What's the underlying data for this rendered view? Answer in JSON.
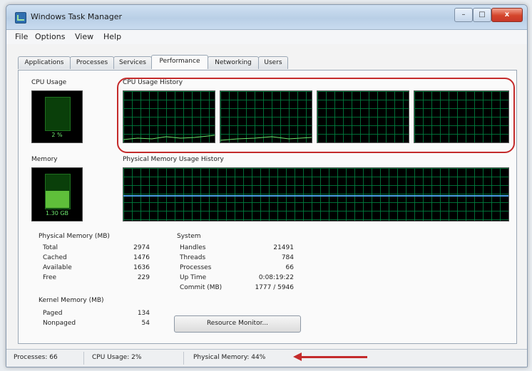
{
  "window": {
    "title": "Windows Task Manager",
    "controls": {
      "minimize": "–",
      "maximize": "□",
      "close": "x"
    }
  },
  "menu": [
    "File",
    "Options",
    "View",
    "Help"
  ],
  "tabs": [
    {
      "label": "Applications",
      "active": false
    },
    {
      "label": "Processes",
      "active": false
    },
    {
      "label": "Services",
      "active": false
    },
    {
      "label": "Performance",
      "active": true
    },
    {
      "label": "Networking",
      "active": false
    },
    {
      "label": "Users",
      "active": false
    }
  ],
  "performance": {
    "cpu_usage_label": "CPU Usage",
    "cpu_usage_value": "2 %",
    "cpu_history_label": "CPU Usage History",
    "memory_label": "Memory",
    "memory_value": "1.30 GB",
    "memory_history_label": "Physical Memory Usage History"
  },
  "physical_memory": {
    "title": "Physical Memory (MB)",
    "rows": [
      {
        "key": "Total",
        "value": "2974"
      },
      {
        "key": "Cached",
        "value": "1476"
      },
      {
        "key": "Available",
        "value": "1636"
      },
      {
        "key": "Free",
        "value": "229"
      }
    ]
  },
  "kernel_memory": {
    "title": "Kernel Memory (MB)",
    "rows": [
      {
        "key": "Paged",
        "value": "134"
      },
      {
        "key": "Nonpaged",
        "value": "54"
      }
    ]
  },
  "system": {
    "title": "System",
    "rows": [
      {
        "key": "Handles",
        "value": "21491"
      },
      {
        "key": "Threads",
        "value": "784"
      },
      {
        "key": "Processes",
        "value": "66"
      },
      {
        "key": "Up Time",
        "value": "0:08:19:22"
      },
      {
        "key": "Commit (MB)",
        "value": "1777 / 5946"
      }
    ]
  },
  "buttons": {
    "resource_monitor": "Resource Monitor..."
  },
  "statusbar": {
    "processes": "Processes: 66",
    "cpu_usage": "CPU Usage: 2%",
    "physical_memory": "Physical Memory: 44%"
  },
  "colors": {
    "graph_bg": "#000000",
    "grid": "#008040",
    "cpu_line": "#6ee86e",
    "memory_line": "#4aa0e6",
    "highlight": "#c42b2b"
  },
  "icons": {
    "app": "task-manager-icon",
    "arrow": "red-arrow-icon"
  }
}
